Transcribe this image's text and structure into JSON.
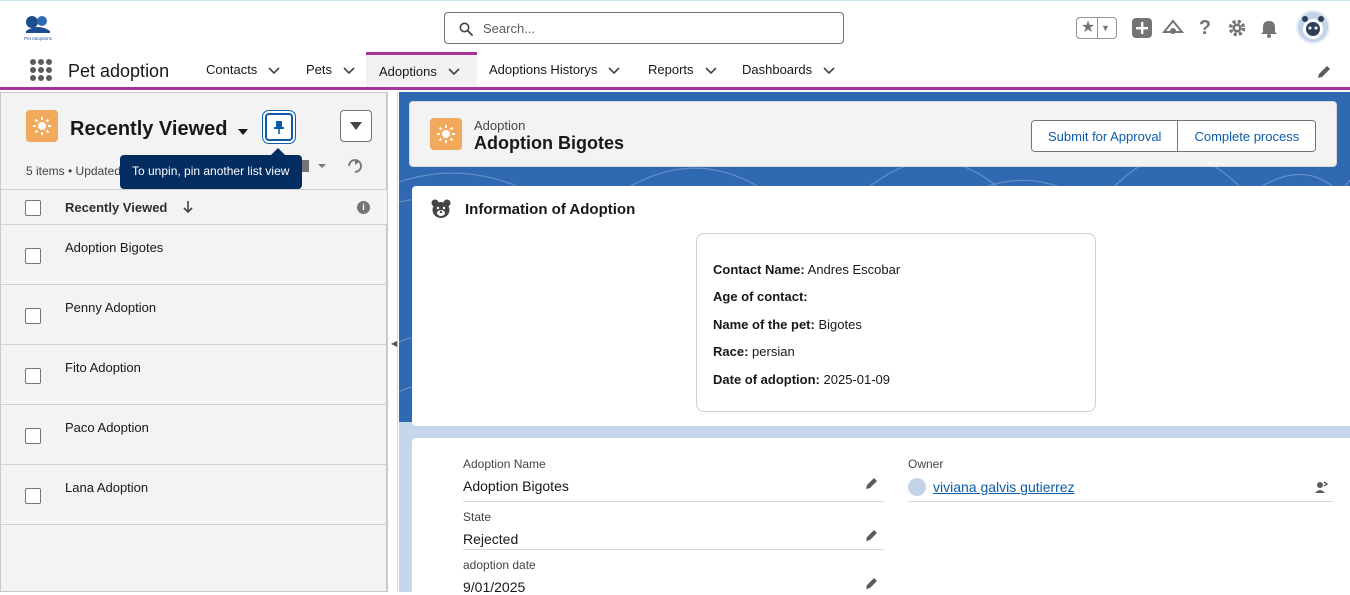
{
  "header": {
    "logo_text": "Pet Adoptions",
    "search_placeholder": "Search..."
  },
  "nav": {
    "app_name": "Pet adoption",
    "tabs": [
      {
        "label": "Contacts",
        "active": false
      },
      {
        "label": "Pets",
        "active": false
      },
      {
        "label": "Adoptions",
        "active": true
      },
      {
        "label": "Adoptions Historys",
        "active": false
      },
      {
        "label": "Reports",
        "active": false
      },
      {
        "label": "Dashboards",
        "active": false
      }
    ]
  },
  "list_view": {
    "title": "Recently Viewed",
    "meta": "5 items • Updated",
    "tooltip": "To unpin, pin another list view",
    "column_header": "Recently Viewed",
    "items": [
      "Adoption Bigotes",
      "Penny Adoption",
      "Fito Adoption",
      "Paco Adoption",
      "Lana Adoption"
    ]
  },
  "record": {
    "object_type": "Adoption",
    "title": "Adoption Bigotes",
    "actions": [
      "Submit for Approval",
      "Complete process"
    ]
  },
  "info_card": {
    "title": "Information of Adoption",
    "lines": [
      {
        "label": "Contact Name:",
        "value": "Andres Escobar"
      },
      {
        "label": "Age of contact:",
        "value": ""
      },
      {
        "label": "Name of the pet:",
        "value": "Bigotes"
      },
      {
        "label": "Race:",
        "value": "persian"
      },
      {
        "label": "Date of adoption:",
        "value": "2025-01-09"
      }
    ]
  },
  "details": {
    "adoption_name_label": "Adoption Name",
    "adoption_name_value": "Adoption Bigotes",
    "owner_label": "Owner",
    "owner_value": "viviana galvis gutierrez",
    "state_label": "State",
    "state_value": "Rejected",
    "date_label": "adoption date",
    "date_value": "9/01/2025"
  },
  "colors": {
    "brand_purple": "#a8349b",
    "link_blue": "#0b5cab",
    "object_orange": "#f1a95b",
    "tooltip_navy": "#032d60",
    "background_blue": "#2f69b2"
  }
}
